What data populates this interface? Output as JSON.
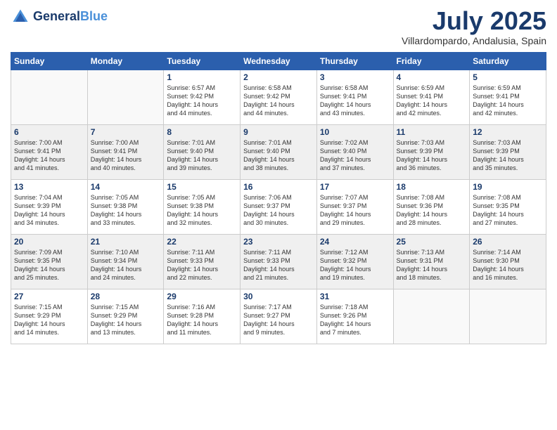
{
  "header": {
    "logo_general": "General",
    "logo_blue": "Blue",
    "month": "July 2025",
    "location": "Villardompardo, Andalusia, Spain"
  },
  "weekdays": [
    "Sunday",
    "Monday",
    "Tuesday",
    "Wednesday",
    "Thursday",
    "Friday",
    "Saturday"
  ],
  "weeks": [
    [
      {
        "day": "",
        "sunrise": "",
        "sunset": "",
        "daylight": ""
      },
      {
        "day": "",
        "sunrise": "",
        "sunset": "",
        "daylight": ""
      },
      {
        "day": "1",
        "sunrise": "Sunrise: 6:57 AM",
        "sunset": "Sunset: 9:42 PM",
        "daylight": "Daylight: 14 hours and 44 minutes."
      },
      {
        "day": "2",
        "sunrise": "Sunrise: 6:58 AM",
        "sunset": "Sunset: 9:42 PM",
        "daylight": "Daylight: 14 hours and 44 minutes."
      },
      {
        "day": "3",
        "sunrise": "Sunrise: 6:58 AM",
        "sunset": "Sunset: 9:41 PM",
        "daylight": "Daylight: 14 hours and 43 minutes."
      },
      {
        "day": "4",
        "sunrise": "Sunrise: 6:59 AM",
        "sunset": "Sunset: 9:41 PM",
        "daylight": "Daylight: 14 hours and 42 minutes."
      },
      {
        "day": "5",
        "sunrise": "Sunrise: 6:59 AM",
        "sunset": "Sunset: 9:41 PM",
        "daylight": "Daylight: 14 hours and 42 minutes."
      }
    ],
    [
      {
        "day": "6",
        "sunrise": "Sunrise: 7:00 AM",
        "sunset": "Sunset: 9:41 PM",
        "daylight": "Daylight: 14 hours and 41 minutes."
      },
      {
        "day": "7",
        "sunrise": "Sunrise: 7:00 AM",
        "sunset": "Sunset: 9:41 PM",
        "daylight": "Daylight: 14 hours and 40 minutes."
      },
      {
        "day": "8",
        "sunrise": "Sunrise: 7:01 AM",
        "sunset": "Sunset: 9:40 PM",
        "daylight": "Daylight: 14 hours and 39 minutes."
      },
      {
        "day": "9",
        "sunrise": "Sunrise: 7:01 AM",
        "sunset": "Sunset: 9:40 PM",
        "daylight": "Daylight: 14 hours and 38 minutes."
      },
      {
        "day": "10",
        "sunrise": "Sunrise: 7:02 AM",
        "sunset": "Sunset: 9:40 PM",
        "daylight": "Daylight: 14 hours and 37 minutes."
      },
      {
        "day": "11",
        "sunrise": "Sunrise: 7:03 AM",
        "sunset": "Sunset: 9:39 PM",
        "daylight": "Daylight: 14 hours and 36 minutes."
      },
      {
        "day": "12",
        "sunrise": "Sunrise: 7:03 AM",
        "sunset": "Sunset: 9:39 PM",
        "daylight": "Daylight: 14 hours and 35 minutes."
      }
    ],
    [
      {
        "day": "13",
        "sunrise": "Sunrise: 7:04 AM",
        "sunset": "Sunset: 9:39 PM",
        "daylight": "Daylight: 14 hours and 34 minutes."
      },
      {
        "day": "14",
        "sunrise": "Sunrise: 7:05 AM",
        "sunset": "Sunset: 9:38 PM",
        "daylight": "Daylight: 14 hours and 33 minutes."
      },
      {
        "day": "15",
        "sunrise": "Sunrise: 7:05 AM",
        "sunset": "Sunset: 9:38 PM",
        "daylight": "Daylight: 14 hours and 32 minutes."
      },
      {
        "day": "16",
        "sunrise": "Sunrise: 7:06 AM",
        "sunset": "Sunset: 9:37 PM",
        "daylight": "Daylight: 14 hours and 30 minutes."
      },
      {
        "day": "17",
        "sunrise": "Sunrise: 7:07 AM",
        "sunset": "Sunset: 9:37 PM",
        "daylight": "Daylight: 14 hours and 29 minutes."
      },
      {
        "day": "18",
        "sunrise": "Sunrise: 7:08 AM",
        "sunset": "Sunset: 9:36 PM",
        "daylight": "Daylight: 14 hours and 28 minutes."
      },
      {
        "day": "19",
        "sunrise": "Sunrise: 7:08 AM",
        "sunset": "Sunset: 9:35 PM",
        "daylight": "Daylight: 14 hours and 27 minutes."
      }
    ],
    [
      {
        "day": "20",
        "sunrise": "Sunrise: 7:09 AM",
        "sunset": "Sunset: 9:35 PM",
        "daylight": "Daylight: 14 hours and 25 minutes."
      },
      {
        "day": "21",
        "sunrise": "Sunrise: 7:10 AM",
        "sunset": "Sunset: 9:34 PM",
        "daylight": "Daylight: 14 hours and 24 minutes."
      },
      {
        "day": "22",
        "sunrise": "Sunrise: 7:11 AM",
        "sunset": "Sunset: 9:33 PM",
        "daylight": "Daylight: 14 hours and 22 minutes."
      },
      {
        "day": "23",
        "sunrise": "Sunrise: 7:11 AM",
        "sunset": "Sunset: 9:33 PM",
        "daylight": "Daylight: 14 hours and 21 minutes."
      },
      {
        "day": "24",
        "sunrise": "Sunrise: 7:12 AM",
        "sunset": "Sunset: 9:32 PM",
        "daylight": "Daylight: 14 hours and 19 minutes."
      },
      {
        "day": "25",
        "sunrise": "Sunrise: 7:13 AM",
        "sunset": "Sunset: 9:31 PM",
        "daylight": "Daylight: 14 hours and 18 minutes."
      },
      {
        "day": "26",
        "sunrise": "Sunrise: 7:14 AM",
        "sunset": "Sunset: 9:30 PM",
        "daylight": "Daylight: 14 hours and 16 minutes."
      }
    ],
    [
      {
        "day": "27",
        "sunrise": "Sunrise: 7:15 AM",
        "sunset": "Sunset: 9:29 PM",
        "daylight": "Daylight: 14 hours and 14 minutes."
      },
      {
        "day": "28",
        "sunrise": "Sunrise: 7:15 AM",
        "sunset": "Sunset: 9:29 PM",
        "daylight": "Daylight: 14 hours and 13 minutes."
      },
      {
        "day": "29",
        "sunrise": "Sunrise: 7:16 AM",
        "sunset": "Sunset: 9:28 PM",
        "daylight": "Daylight: 14 hours and 11 minutes."
      },
      {
        "day": "30",
        "sunrise": "Sunrise: 7:17 AM",
        "sunset": "Sunset: 9:27 PM",
        "daylight": "Daylight: 14 hours and 9 minutes."
      },
      {
        "day": "31",
        "sunrise": "Sunrise: 7:18 AM",
        "sunset": "Sunset: 9:26 PM",
        "daylight": "Daylight: 14 hours and 7 minutes."
      },
      {
        "day": "",
        "sunrise": "",
        "sunset": "",
        "daylight": ""
      },
      {
        "day": "",
        "sunrise": "",
        "sunset": "",
        "daylight": ""
      }
    ]
  ]
}
